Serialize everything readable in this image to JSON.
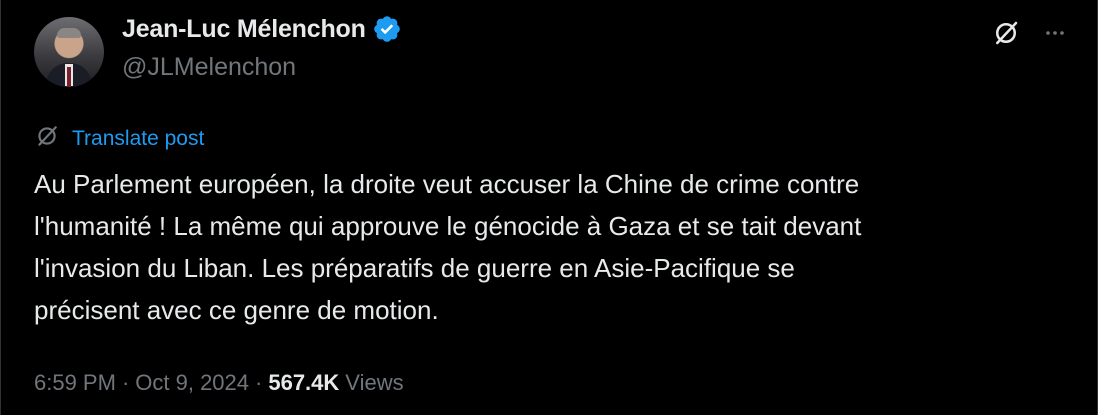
{
  "author": {
    "display_name": "Jean-Luc Mélenchon",
    "handle": "@JLMelenchon",
    "verified": true,
    "verified_color": "#1d9bf0"
  },
  "actions": {
    "grok_icon": "grok-slash-icon",
    "more_icon": "more-horizontal-icon"
  },
  "translate": {
    "icon": "translate-icon",
    "label": "Translate post"
  },
  "post": {
    "text": "Au Parlement européen, la droite veut accuser la Chine de crime contre\nl'humanité ! La même qui approuve le génocide à Gaza et se tait devant\nl'invasion du Liban. Les préparatifs de guerre en Asie-Pacifique se\nprécisent avec ce genre de motion."
  },
  "meta": {
    "time": "6:59 PM",
    "separator": "·",
    "date": "Oct 9, 2024",
    "views_count": "567.4K",
    "views_label": "Views"
  },
  "colors": {
    "background": "#000000",
    "text_primary": "#e7e9ea",
    "text_secondary": "#71767b",
    "accent": "#1d9bf0"
  }
}
